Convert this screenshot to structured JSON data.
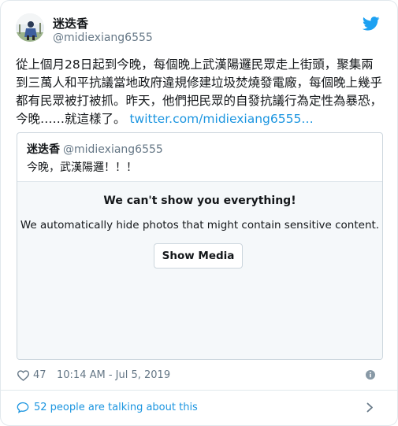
{
  "author": {
    "name": "迷迭香",
    "handle": "@midiexiang6555"
  },
  "tweet": {
    "text": "從上個月28日起到今晚，每個晚上武漢陽邏民眾走上街頭，聚集兩到三萬人和平抗議當地政府違規修建垃圾焚燒發電廠，每個晚上幾乎都有民眾被打被抓。昨天，他們把民眾的自發抗議行為定性為暴恐，今晚……就這樣了。",
    "link_text": "twitter.com/midiexiang6555…"
  },
  "quote": {
    "name": "迷迭香",
    "handle": "@midiexiang6555",
    "text": "今晚，武漢陽邏！！！",
    "sensitive_title": "We can't show you everything!",
    "sensitive_description": "We automatically hide photos that might contain sensitive content.",
    "show_media_label": "Show Media"
  },
  "meta": {
    "likes": "47",
    "timestamp": "10:14 AM - Jul 5, 2019"
  },
  "footer": {
    "talking_label": "52 people are talking about this"
  },
  "icons": {
    "logo": "twitter-bird-icon",
    "like": "heart-icon",
    "info": "info-icon",
    "comments": "speech-bubble-icon",
    "chevron": "chevron-right-icon"
  },
  "colors": {
    "twitter_blue": "#1da1f2",
    "link": "#1b95e0",
    "muted": "#657786",
    "media_bg": "#f5f8fa",
    "border": "#e1e8ed"
  }
}
